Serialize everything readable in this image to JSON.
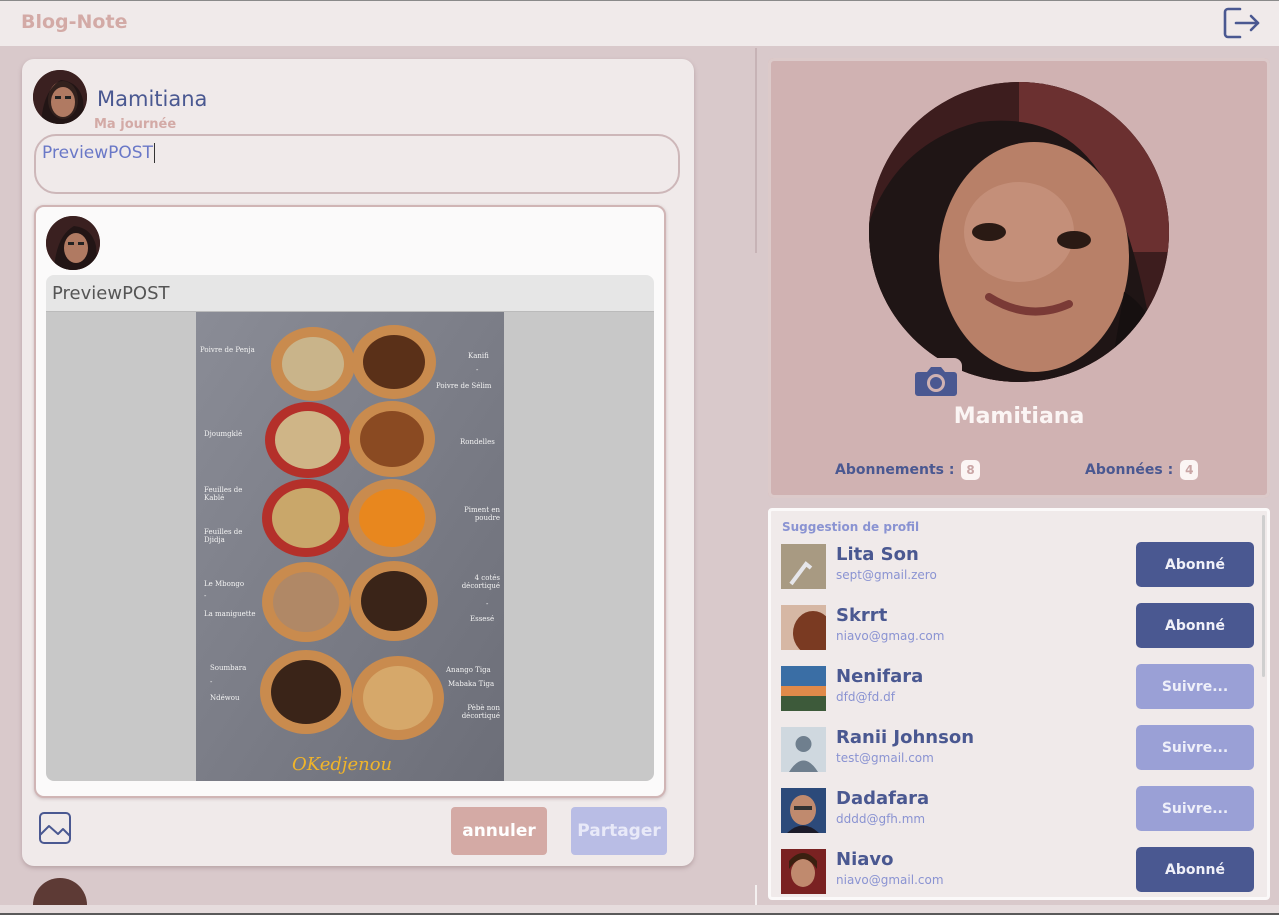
{
  "app": {
    "brand": "Blog-Note"
  },
  "composer": {
    "author_name": "Mamitiana",
    "author_subtitle": "Ma journée",
    "input_value": "PreviewPOST",
    "preview_title": "PreviewPOST",
    "cancel_label": "annuler",
    "share_label": "Partager"
  },
  "spice_image": {
    "labels_left": [
      "Poivre de Penja",
      "Djoumgklé",
      "Feuilles de Kablé",
      "Feuilles de Djidja",
      "Le Mbongo",
      "-",
      "La maniguette",
      "Soumbara",
      "-",
      "Ndéwou"
    ],
    "labels_right": [
      "Kanifi",
      "-",
      "Poivre de Sélim",
      "Rondelles",
      "Piment en poudre",
      "4 cotés décortiqué",
      "-",
      "Essesé",
      "Anango Tiga",
      "Mabaka Tiga",
      "Pèbè non décortiqué"
    ],
    "watermark": "OKedjenou"
  },
  "profile": {
    "name": "Mamitiana",
    "abonnements_label": "Abonnements :",
    "abonnements_count": "8",
    "abonnees_label": "Abonnées :",
    "abonnees_count": "4"
  },
  "suggestions": {
    "title": "Suggestion de profil",
    "items": [
      {
        "name": "Lita Son",
        "email": "sept@gmail.zero",
        "button": "Abonné",
        "followed": true
      },
      {
        "name": "Skrrt",
        "email": "niavo@gmag.com",
        "button": "Abonné",
        "followed": true
      },
      {
        "name": "Nenifara",
        "email": "dfd@fd.df",
        "button": "Suivre...",
        "followed": false
      },
      {
        "name": "Ranii Johnson",
        "email": "test@gmail.com",
        "button": "Suivre...",
        "followed": false
      },
      {
        "name": "Dadafara",
        "email": "dddd@gfh.mm",
        "button": "Suivre...",
        "followed": false
      },
      {
        "name": "Niavo",
        "email": "niavo@gmail.com",
        "button": "Abonné",
        "followed": true
      }
    ]
  },
  "colors": {
    "accent": "#4a5891",
    "rose": "#d3aaa6",
    "follow_inactive": "#9aa0d6"
  }
}
